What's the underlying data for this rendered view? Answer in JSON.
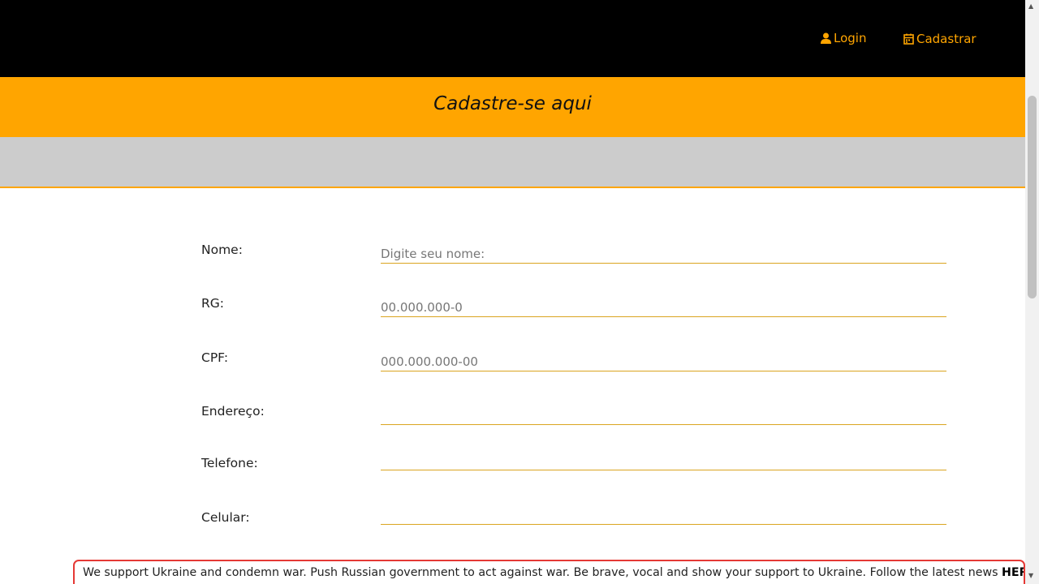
{
  "nav": {
    "login_label": "Login",
    "register_label": "Cadastrar",
    "login_icon": "user-icon",
    "register_icon": "calendar-icon"
  },
  "hero": {
    "title": "Cadastre-se aqui"
  },
  "form": {
    "fields": [
      {
        "label": "Nome:",
        "placeholder": "Digite seu nome:"
      },
      {
        "label": "RG:",
        "placeholder": "00.000.000-0"
      },
      {
        "label": "CPF:",
        "placeholder": "000.000.000-00"
      },
      {
        "label": "Endereço:",
        "placeholder": ""
      },
      {
        "label": "Telefone:",
        "placeholder": ""
      },
      {
        "label": "Celular:",
        "placeholder": ""
      }
    ]
  },
  "banner": {
    "text": "We support Ukraine and condemn war. Push Russian government to act against war. Be brave, vocal and show your support to Ukraine. Follow the latest news",
    "link_label": "HERE"
  },
  "colors": {
    "accent": "#FFA500",
    "navbar_bg": "#000000",
    "band_gray": "#CCCCCC",
    "banner_border": "#E53935"
  }
}
